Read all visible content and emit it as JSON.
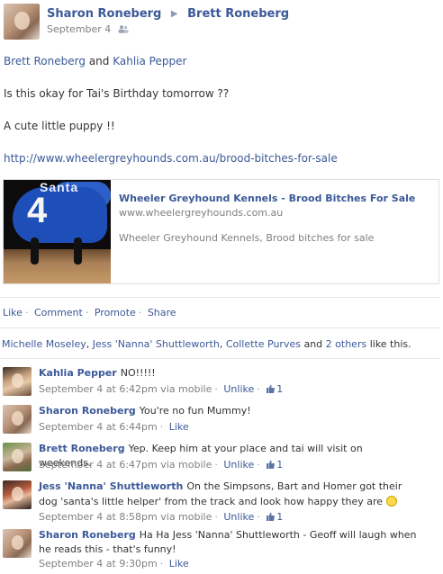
{
  "post": {
    "author": "Sharon Roneberg",
    "target": "Brett Roneberg",
    "date": "September 4",
    "tags": [
      {
        "name": "Brett Roneberg"
      },
      {
        "joiner": "and"
      },
      {
        "name": "Kahlia Pepper"
      }
    ],
    "line1": "Is this okay for Tai's Birthday tomorrow ??",
    "line2": "A cute little puppy !!",
    "url": "http://www.wheelergreyhounds.com.au/brood-bitches-for-sale"
  },
  "attachment": {
    "title": "Wheeler Greyhound Kennels - Brood Bitches For Sale",
    "url": "www.wheelergreyhounds.com.au",
    "description": "Wheeler Greyhound Kennels, Brood bitches for sale",
    "thumb_number": "4",
    "thumb_text": "Santa"
  },
  "actions": {
    "like": "Like",
    "comment": "Comment",
    "promote": "Promote",
    "share": "Share"
  },
  "likes": {
    "person1": "Michelle Moseley",
    "person2": "Jess 'Nanna' Shuttleworth",
    "person3": "Collette Purves",
    "and": "and",
    "others": "2 others",
    "suffix": "like this."
  },
  "comments": [
    {
      "name": "Kahlia Pepper",
      "text": "NO!!!!!",
      "time": "September 4 at 6:42pm",
      "via": "via mobile",
      "action": "Unlike",
      "likes": "1"
    },
    {
      "name": "Sharon Roneberg",
      "text": "You're no fun Mummy!",
      "time": "September 4 at 6:44pm",
      "via": "",
      "action": "Like",
      "likes": ""
    },
    {
      "name": "Brett Roneberg",
      "text": "Yep. Keep him at your place and tai will visit on weekends.",
      "time": "September 4 at 6:47pm",
      "via": "via mobile",
      "action": "Unlike",
      "likes": "1"
    },
    {
      "name": "Jess 'Nanna' Shuttleworth",
      "text": "On the Simpsons, Bart and Homer got their dog 'santa's little helper' from the track and look how happy they are",
      "time": "September 4 at 8:58pm",
      "via": "via mobile",
      "action": "Unlike",
      "likes": "1"
    },
    {
      "name": "Sharon Roneberg",
      "text": "Ha Ha Jess 'Nanna' Shuttleworth - Geoff will laugh when he reads this - that's funny!",
      "time": "September 4 at 9:30pm",
      "via": "",
      "action": "Like",
      "likes": ""
    }
  ],
  "icons": {
    "audience": "friends-audience-icon",
    "arrow": "right-triangle-icon",
    "like": "thumbs-up-icon",
    "emoji": "smiley-icon"
  },
  "colors": {
    "link": "#3b5998",
    "meta": "#808080",
    "text": "#333333"
  }
}
